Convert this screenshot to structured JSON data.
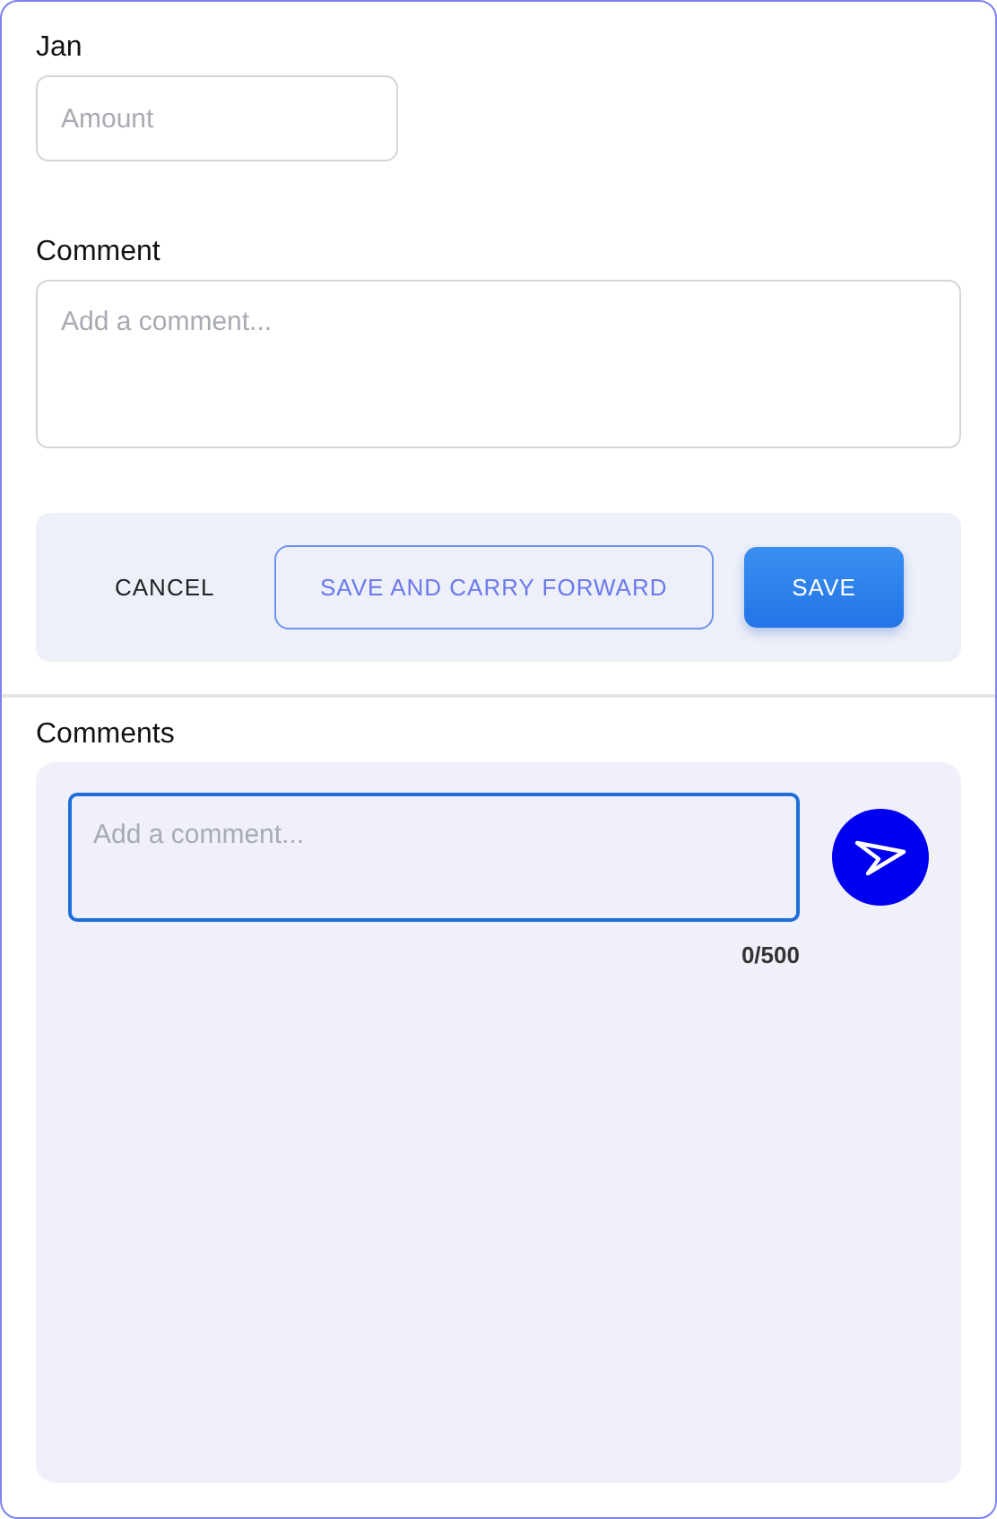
{
  "amount_field": {
    "label": "Jan",
    "placeholder": "Amount"
  },
  "comment_field": {
    "label": "Comment",
    "placeholder": "Add a comment..."
  },
  "actions": [
    {
      "label": "CANCEL",
      "kind": "text"
    },
    {
      "label": "SAVE AND CARRY FORWARD",
      "kind": "outlined"
    },
    {
      "label": "SAVE",
      "kind": "filled"
    }
  ],
  "comments": {
    "title": "Comments",
    "placeholder": "Add a comment...",
    "counter": "0/500"
  }
}
